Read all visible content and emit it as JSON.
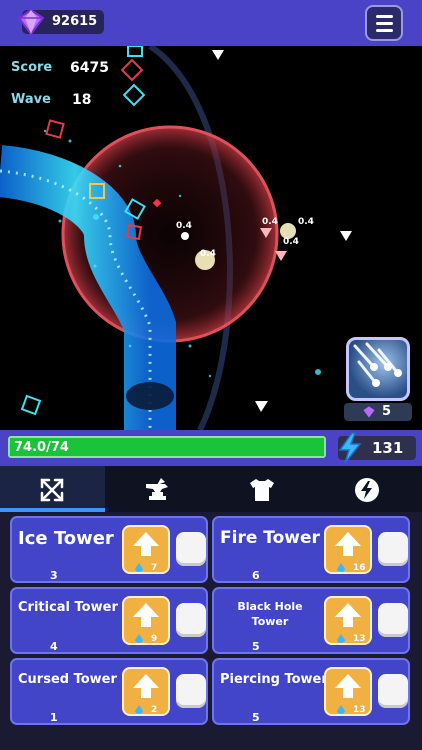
{
  "header": {
    "gems": "92615"
  },
  "stats": {
    "score_label": "Score",
    "score": "6475",
    "wave_label": "Wave",
    "wave": "18"
  },
  "damage_numbers": [
    "0.4",
    "0.4",
    "0.4",
    "0.4",
    "0.4"
  ],
  "ability": {
    "icon": "meteor-shower-icon",
    "cost": "5"
  },
  "health": {
    "text": "74.0/74",
    "current": 74,
    "max": 74
  },
  "energy": {
    "value": "131"
  },
  "tabs": [
    {
      "icon": "crossed-arrows-icon",
      "active": true
    },
    {
      "icon": "anvil-icon",
      "active": false
    },
    {
      "icon": "armor-icon",
      "active": false
    },
    {
      "icon": "lightning-icon",
      "active": false
    }
  ],
  "towers": [
    {
      "name": "Ice Tower",
      "level": "3",
      "cost": "7"
    },
    {
      "name": "Fire Tower",
      "level": "6",
      "cost": "16"
    },
    {
      "name": "Critical Tower",
      "level": "4",
      "cost": "9"
    },
    {
      "name": "Black Hole Tower",
      "level": "5",
      "cost": "13"
    },
    {
      "name": "Cursed Tower",
      "level": "1",
      "cost": "2"
    },
    {
      "name": "Piercing Tower",
      "level": "5",
      "cost": "13"
    }
  ],
  "colors": {
    "accent": "#4a43c8",
    "health": "#19c43a",
    "upgrade": "#f0b042",
    "card": "#4245c8"
  }
}
